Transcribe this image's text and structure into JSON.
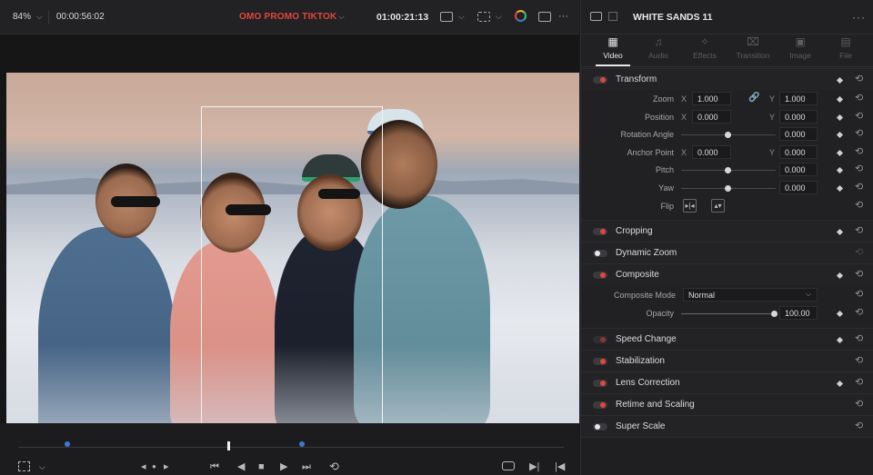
{
  "viewer": {
    "zoom": "84%",
    "timecode_left": "00:00:56:02",
    "clip_title": "OMO PROMO TIKTOK",
    "timecode_right": "01:00:21:13"
  },
  "icons": {
    "chevron": "⌵",
    "more": "···",
    "link": "🔗",
    "reset": "⟲",
    "flip_h": "▸|◂",
    "flip_v": "▴▾",
    "prev_edit": "◂",
    "dot": "●",
    "next_edit": "▸",
    "to_start": "⏮",
    "reverse": "◀",
    "stop": "■",
    "play": "▶",
    "to_end": "⏭",
    "loop": "⟲",
    "match": "⎵",
    "next_frame": "▶|",
    "prev_frame": "|◀"
  },
  "inspector": {
    "title": "WHITE SANDS 11",
    "tabs": [
      {
        "label": "Video",
        "icon": "▦",
        "active": true
      },
      {
        "label": "Audio",
        "icon": "♫",
        "active": false
      },
      {
        "label": "Effects",
        "icon": "✧",
        "active": false
      },
      {
        "label": "Transition",
        "icon": "⌧",
        "active": false
      },
      {
        "label": "Image",
        "icon": "▣",
        "active": false
      },
      {
        "label": "File",
        "icon": "▤",
        "active": false
      }
    ],
    "transform": {
      "label": "Transform",
      "zoom": {
        "label": "Zoom",
        "x_axis": "X",
        "x": "1.000",
        "y_axis": "Y",
        "y": "1.000"
      },
      "position": {
        "label": "Position",
        "x_axis": "X",
        "x": "0.000",
        "y_axis": "Y",
        "y": "0.000"
      },
      "rotation": {
        "label": "Rotation Angle",
        "value": "0.000"
      },
      "anchor": {
        "label": "Anchor Point",
        "x_axis": "X",
        "x": "0.000",
        "y_axis": "Y",
        "y": "0.000"
      },
      "pitch": {
        "label": "Pitch",
        "value": "0.000"
      },
      "yaw": {
        "label": "Yaw",
        "value": "0.000"
      },
      "flip": {
        "label": "Flip"
      }
    },
    "sections": {
      "cropping": "Cropping",
      "dynamic_zoom": "Dynamic Zoom",
      "composite": "Composite",
      "speed_change": "Speed Change",
      "stabilization": "Stabilization",
      "lens_correction": "Lens Correction",
      "retime_scaling": "Retime and Scaling",
      "super_scale": "Super Scale"
    },
    "composite": {
      "mode_label": "Composite Mode",
      "mode_value": "Normal",
      "opacity_label": "Opacity",
      "opacity_value": "100.00"
    }
  },
  "colors": {
    "accent_red": "#e2463c",
    "keyframe_blue": "#3b7bd6",
    "panel_bg": "#212124"
  }
}
